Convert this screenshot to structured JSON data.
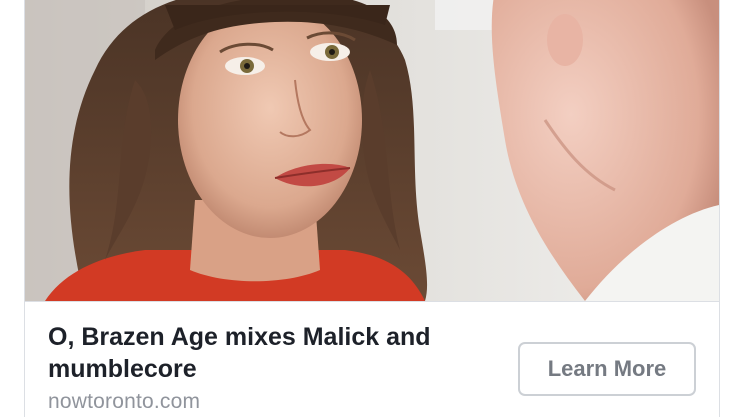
{
  "ad_card": {
    "image": {
      "description_icon": "photo-woman-in-red-looking-at-man"
    },
    "headline": "O, Brazen Age mixes Malick and mumblecore",
    "domain": "nowtoronto.com",
    "cta_label": "Learn More"
  },
  "colors": {
    "headline_text": "#1d2129",
    "domain_text": "#90949c",
    "button_border": "#ccd0d5",
    "button_text": "#757a82",
    "card_border": "#dcdfe4"
  }
}
